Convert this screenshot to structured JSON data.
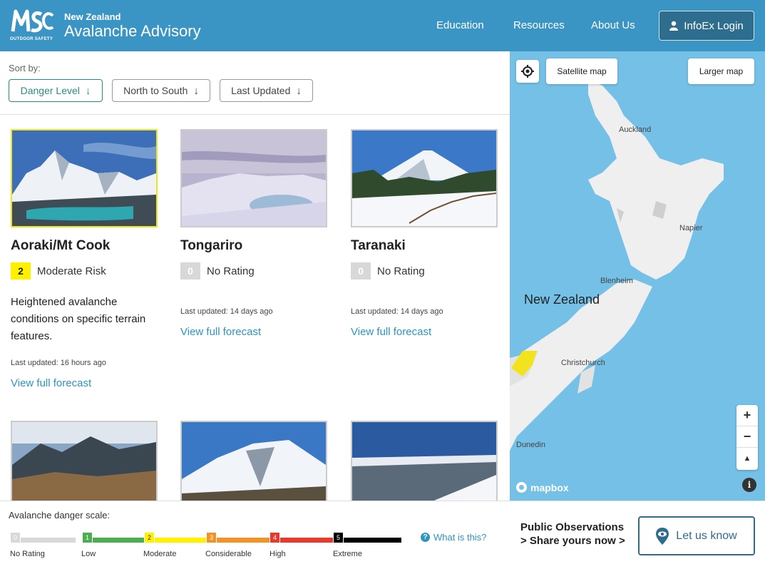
{
  "header": {
    "logo_text": "MSC",
    "logo_subtext": "OUTDOOR SAFETY",
    "brand_small": "New Zealand",
    "brand_large": "Avalanche Advisory",
    "nav": [
      {
        "label": "Education"
      },
      {
        "label": "Resources"
      },
      {
        "label": "About Us"
      }
    ],
    "login_label": "InfoEx Login",
    "color_primary": "#3b95c4"
  },
  "sort": {
    "label": "Sort by:",
    "options": [
      {
        "label": "Danger Level",
        "active": true
      },
      {
        "label": "North to South",
        "active": false
      },
      {
        "label": "Last Updated",
        "active": false
      }
    ]
  },
  "cards": [
    {
      "title": "Aoraki/Mt Cook",
      "rating_value": "2",
      "rating_text": "Moderate Risk",
      "description": "Heightened avalanche conditions on specific terrain features.",
      "updated": "Last updated: 16 hours ago",
      "link": "View full forecast"
    },
    {
      "title": "Tongariro",
      "rating_value": "0",
      "rating_text": "No Rating",
      "updated": "Last updated: 14 days ago",
      "link": "View full forecast"
    },
    {
      "title": "Taranaki",
      "rating_value": "0",
      "rating_text": "No Rating",
      "updated": "Last updated: 14 days ago",
      "link": "View full forecast"
    }
  ],
  "map": {
    "satellite_label": "Satellite map",
    "larger_label": "Larger map",
    "places": {
      "auckland": "Auckland",
      "napier": "Napier",
      "blenheim": "Blenheim",
      "nz": "New Zealand",
      "christchurch": "Christchurch",
      "dunedin": "Dunedin"
    },
    "zoom_in": "+",
    "zoom_out": "−",
    "compass": "▲",
    "attribution": "mapbox",
    "info": "i"
  },
  "footer": {
    "scale_title": "Avalanche danger scale:",
    "scale": [
      {
        "num": "0",
        "label": "No Rating",
        "color": "#d8d8d8"
      },
      {
        "num": "1",
        "label": "Low",
        "color": "#4caf4f"
      },
      {
        "num": "2",
        "label": "Moderate",
        "color": "#fff200"
      },
      {
        "num": "3",
        "label": "Considerable",
        "color": "#f29227"
      },
      {
        "num": "4",
        "label": "High",
        "color": "#e8392b"
      },
      {
        "num": "5",
        "label": "Extreme",
        "color": "#000000"
      }
    ],
    "what_label": "What is this?",
    "obs_title": "Public Observations",
    "obs_sub": "> Share yours now >",
    "letus_label": "Let us know"
  }
}
